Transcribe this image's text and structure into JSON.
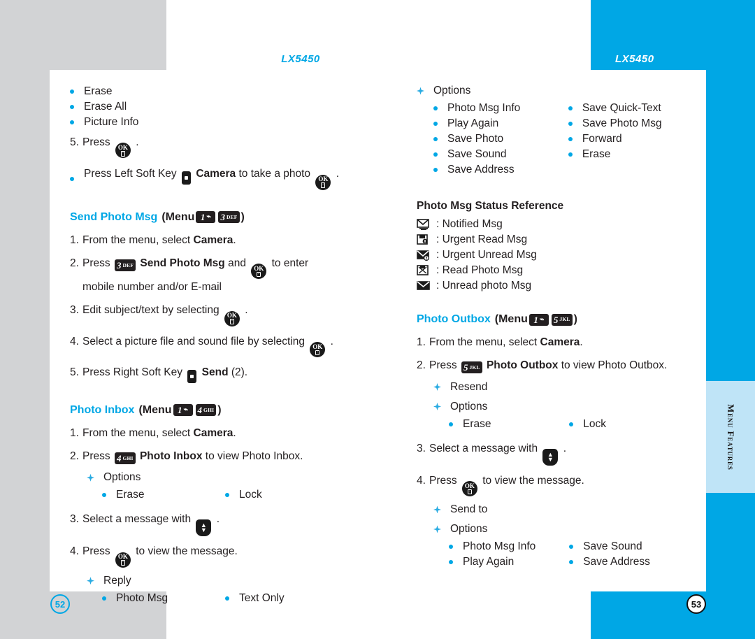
{
  "document": {
    "product": "LX5450",
    "side_tab": "Menu Features",
    "page_left": "52",
    "page_right": "53",
    "accent": "#00a7e5",
    "gray": "#d2d3d5"
  },
  "left_page": {
    "top_bullets": [
      "Erase",
      "Erase All",
      "Picture Info"
    ],
    "step5": {
      "num": "5.",
      "text": "Press",
      "tail": "."
    },
    "softkey_note": {
      "pre": "Press Left Soft Key",
      "bold": "Camera",
      "mid": "to take a photo",
      "tail": "."
    },
    "send_photo_msg": {
      "title": "Send Photo Msg",
      "menu_label": "(Menu",
      "key1": {
        "num": "1",
        "letters": ""
      },
      "key2": {
        "num": "3",
        "letters": "DEF"
      },
      "close": ")",
      "steps": [
        {
          "num": "1.",
          "pre": "From the menu, select",
          "bold": "Camera",
          "post": "."
        },
        {
          "num": "2.",
          "pre": "Press",
          "key": {
            "num": "3",
            "letters": "DEF"
          },
          "bold": "Send Photo Msg",
          "mid": "and",
          "ok": true,
          "post": "to enter",
          "line2": "mobile number and/or E-mail"
        },
        {
          "num": "3.",
          "pre": "Edit subject/text by selecting",
          "ok": true,
          "post": "."
        },
        {
          "num": "4.",
          "pre": "Select a picture file and sound file by selecting",
          "ok": true,
          "post": "."
        },
        {
          "num": "5.",
          "pre": "Press Right Soft Key",
          "softkey": true,
          "bold": "Send",
          "post": "(2)."
        }
      ]
    },
    "photo_inbox": {
      "title": "Photo Inbox",
      "menu_label": "(Menu",
      "key1": {
        "num": "1",
        "letters": ""
      },
      "key2": {
        "num": "4",
        "letters": "GHI"
      },
      "close": ")",
      "step1": {
        "num": "1.",
        "pre": "From the menu, select",
        "bold": "Camera",
        "post": "."
      },
      "step2": {
        "num": "2.",
        "pre": "Press",
        "key": {
          "num": "4",
          "letters": "GHI"
        },
        "bold": "Photo Inbox",
        "post": "to view Photo Inbox."
      },
      "options_label": "Options",
      "options": [
        "Erase",
        "Lock"
      ],
      "step3": {
        "num": "3.",
        "pre": "Select a message with",
        "post": "."
      },
      "step4": {
        "num": "4.",
        "pre": "Press",
        "post": "to view the message."
      },
      "reply_label": "Reply",
      "reply_options": [
        "Photo Msg",
        "Text Only"
      ]
    }
  },
  "right_page": {
    "options_label": "Options",
    "options_col1": [
      "Photo Msg Info",
      "Play Again",
      "Save Photo",
      "Save Sound",
      "Save Address"
    ],
    "options_col2": [
      "Save Quick-Text",
      "Save Photo Msg",
      "Forward",
      "Erase"
    ],
    "status_reference": {
      "heading": "Photo Msg Status Reference",
      "rows": [
        {
          "icon": "notified-msg-icon",
          "label": ": Notified Msg"
        },
        {
          "icon": "urgent-read-msg-icon",
          "label": ": Urgent Read Msg"
        },
        {
          "icon": "urgent-unread-msg-icon",
          "label": ": Urgent Unread Msg"
        },
        {
          "icon": "read-photo-msg-icon",
          "label": ": Read Photo Msg"
        },
        {
          "icon": "unread-photo-msg-icon",
          "label": ": Unread photo Msg"
        }
      ]
    },
    "photo_outbox": {
      "title": "Photo Outbox",
      "menu_label": "(Menu",
      "key1": {
        "num": "1",
        "letters": ""
      },
      "key2": {
        "num": "5",
        "letters": "JKL"
      },
      "close": ")",
      "step1": {
        "num": "1.",
        "pre": "From the menu, select",
        "bold": "Camera",
        "post": "."
      },
      "step2": {
        "num": "2.",
        "pre": "Press",
        "key": {
          "num": "5",
          "letters": "JKL"
        },
        "bold": "Photo Outbox",
        "post": "to view Photo Outbox."
      },
      "resend_label": "Resend",
      "options_label": "Options",
      "options": [
        "Erase",
        "Lock"
      ],
      "step3": {
        "num": "3.",
        "pre": "Select a message with",
        "post": "."
      },
      "step4": {
        "num": "4.",
        "pre": "Press",
        "post": "to view the message."
      },
      "send_to_label": "Send to",
      "options2_label": "Options",
      "options2_col1": [
        "Photo Msg Info",
        "Play Again"
      ],
      "options2_col2": [
        "Save Sound",
        "Save Address"
      ]
    }
  }
}
